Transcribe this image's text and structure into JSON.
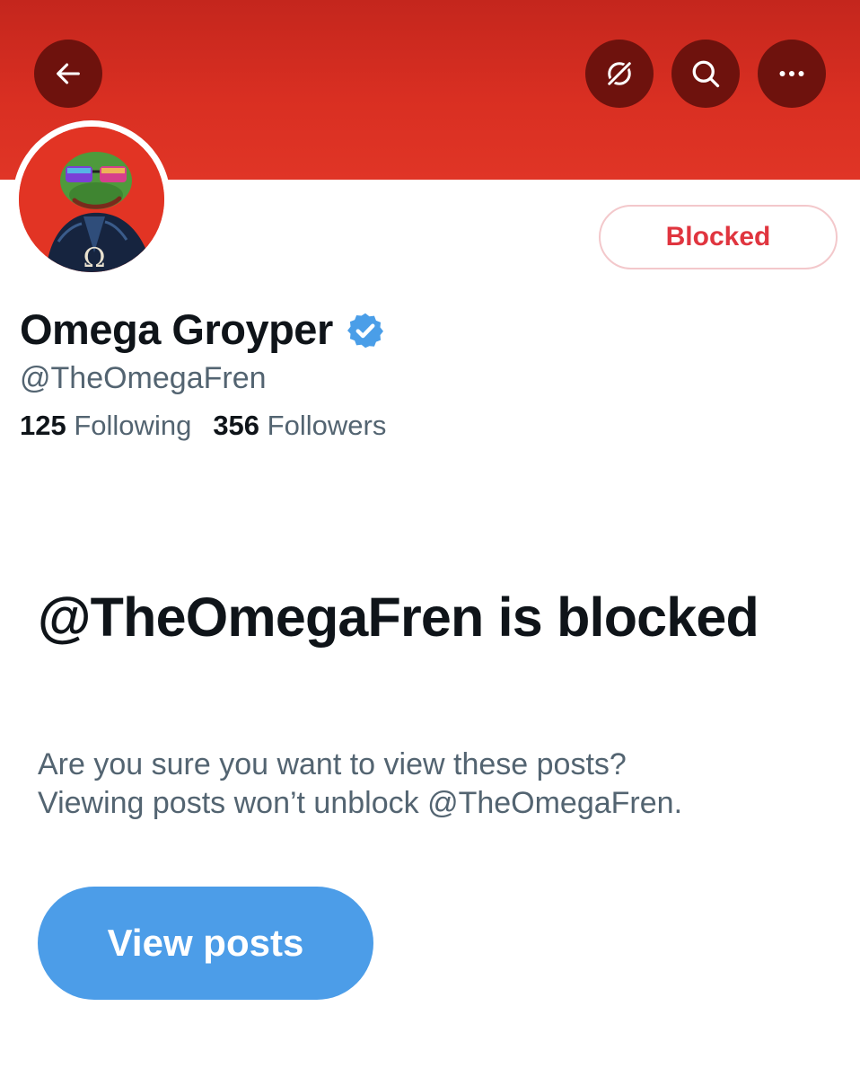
{
  "header": {
    "banner_color": "#d92f22",
    "back_icon": "arrow-left-icon",
    "actions": [
      {
        "icon": "no-notifications-icon"
      },
      {
        "icon": "search-icon"
      },
      {
        "icon": "more-icon"
      }
    ]
  },
  "profile": {
    "display_name": "Omega Groyper",
    "verified": true,
    "handle": "@TheOmegaFren",
    "following_count": "125",
    "following_label": "Following",
    "followers_count": "356",
    "followers_label": "Followers",
    "avatar": {
      "description": "avatar-image",
      "background": "#e23424",
      "glyph": "Ω"
    },
    "blocked_button_label": "Blocked"
  },
  "blocked_notice": {
    "title": "@TheOmegaFren is blocked",
    "description_line1": "Are you sure you want to view these posts?",
    "description_line2": "Viewing posts won’t unblock @TheOmegaFren.",
    "view_button_label": "View posts"
  },
  "colors": {
    "accent_blue": "#4c9de8",
    "blocked_red": "#e0353f",
    "muted_text": "#536471",
    "primary_text": "#0f1419"
  }
}
